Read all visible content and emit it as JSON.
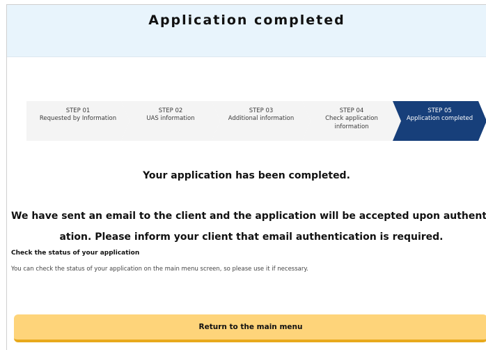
{
  "header": {
    "title": "Application completed"
  },
  "steps": [
    {
      "num": "STEP 01",
      "label": "Requested by Information",
      "active": false
    },
    {
      "num": "STEP 02",
      "label": "UAS information",
      "active": false
    },
    {
      "num": "STEP 03",
      "label": "Additional information",
      "active": false
    },
    {
      "num": "STEP 04",
      "label": "Check application information",
      "active": false
    },
    {
      "num": "STEP 05",
      "label": "Application completed",
      "active": true
    }
  ],
  "main": {
    "completed_message": "Your application has been completed.",
    "email_message_line1": "We have sent an email to the client and the application will be accepted upon authentic",
    "email_message_line2": "ation. Please inform your client that email authentication is required.",
    "status_title": "Check the status of your application",
    "status_description": "You can check the status of your application on the main menu screen, so please use it if necessary."
  },
  "actions": {
    "return_label": "Return to the main menu"
  },
  "colors": {
    "header_bg": "#e8f4fc",
    "active_step": "#173f7a",
    "button_bg": "#fed47a",
    "button_border": "#e8a91c"
  }
}
